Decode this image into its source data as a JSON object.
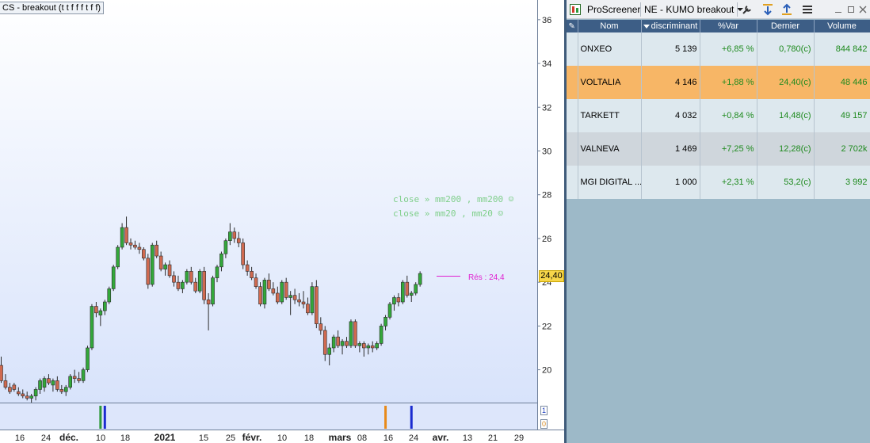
{
  "chart": {
    "title": "CS - breakout (t t f f f t f f)",
    "last_price_tag": "24,40",
    "resistance_label": "Rés : 24,4",
    "screener_notes": [
      "close » mm200 , mm200 ☺",
      "close » mm20 , mm20 ☺"
    ],
    "indicator_scale": [
      "1",
      "0"
    ]
  },
  "chart_data": {
    "type": "candlestick",
    "title": "CS - breakout (t t f f f t f f)",
    "y_ticks": [
      20,
      22,
      24,
      26,
      28,
      30,
      32,
      34,
      36
    ],
    "ylim": [
      18.5,
      36.9
    ],
    "x_ticks": [
      "16",
      "24",
      "déc.",
      "10",
      "18",
      "2021",
      "15",
      "25",
      "févr.",
      "10",
      "18",
      "mars",
      "08",
      "16",
      "24",
      "avr.",
      "13",
      "21",
      "29"
    ],
    "last_price": 24.4,
    "resistance": 24.4,
    "candles": [
      {
        "o": 20.2,
        "h": 20.6,
        "l": 19.4,
        "c": 19.5
      },
      {
        "o": 19.5,
        "h": 19.8,
        "l": 19.1,
        "c": 19.2
      },
      {
        "o": 19.2,
        "h": 19.4,
        "l": 18.9,
        "c": 19.0
      },
      {
        "o": 19.3,
        "h": 19.4,
        "l": 19.0,
        "c": 19.1
      },
      {
        "o": 19.0,
        "h": 19.2,
        "l": 18.8,
        "c": 18.9
      },
      {
        "o": 18.9,
        "h": 19.1,
        "l": 18.7,
        "c": 18.8
      },
      {
        "o": 18.8,
        "h": 19.0,
        "l": 18.6,
        "c": 18.7
      },
      {
        "o": 18.7,
        "h": 18.9,
        "l": 18.5,
        "c": 18.8
      },
      {
        "o": 18.8,
        "h": 19.2,
        "l": 18.6,
        "c": 19.1
      },
      {
        "o": 19.1,
        "h": 19.6,
        "l": 18.9,
        "c": 19.5
      },
      {
        "o": 19.2,
        "h": 19.7,
        "l": 19.0,
        "c": 19.6
      },
      {
        "o": 19.6,
        "h": 19.8,
        "l": 19.3,
        "c": 19.4
      },
      {
        "o": 19.3,
        "h": 19.6,
        "l": 19.0,
        "c": 19.5
      },
      {
        "o": 19.5,
        "h": 19.7,
        "l": 19.0,
        "c": 19.1
      },
      {
        "o": 19.1,
        "h": 19.3,
        "l": 18.9,
        "c": 19.0
      },
      {
        "o": 19.0,
        "h": 19.3,
        "l": 18.8,
        "c": 19.2
      },
      {
        "o": 19.2,
        "h": 19.8,
        "l": 19.1,
        "c": 19.7
      },
      {
        "o": 19.7,
        "h": 20.0,
        "l": 19.4,
        "c": 19.6
      },
      {
        "o": 19.6,
        "h": 19.9,
        "l": 19.4,
        "c": 19.5
      },
      {
        "o": 19.5,
        "h": 20.1,
        "l": 19.4,
        "c": 20.0
      },
      {
        "o": 20.0,
        "h": 21.1,
        "l": 19.9,
        "c": 21.0
      },
      {
        "o": 21.0,
        "h": 23.0,
        "l": 20.9,
        "c": 22.9
      },
      {
        "o": 22.9,
        "h": 23.1,
        "l": 22.4,
        "c": 22.6
      },
      {
        "o": 22.5,
        "h": 22.8,
        "l": 22.0,
        "c": 22.7
      },
      {
        "o": 22.7,
        "h": 23.2,
        "l": 22.5,
        "c": 23.1
      },
      {
        "o": 23.1,
        "h": 23.8,
        "l": 23.0,
        "c": 23.7
      },
      {
        "o": 23.7,
        "h": 24.8,
        "l": 23.6,
        "c": 24.7
      },
      {
        "o": 24.7,
        "h": 25.7,
        "l": 24.6,
        "c": 25.6
      },
      {
        "o": 25.6,
        "h": 26.7,
        "l": 25.5,
        "c": 26.5
      },
      {
        "o": 26.5,
        "h": 27.0,
        "l": 25.7,
        "c": 25.8
      },
      {
        "o": 25.8,
        "h": 26.0,
        "l": 25.5,
        "c": 25.7
      },
      {
        "o": 25.7,
        "h": 25.9,
        "l": 25.5,
        "c": 25.6
      },
      {
        "o": 25.6,
        "h": 25.8,
        "l": 25.3,
        "c": 25.5
      },
      {
        "o": 25.5,
        "h": 25.6,
        "l": 25.0,
        "c": 25.1
      },
      {
        "o": 25.1,
        "h": 25.3,
        "l": 23.7,
        "c": 23.9
      },
      {
        "o": 23.9,
        "h": 25.8,
        "l": 23.8,
        "c": 25.7
      },
      {
        "o": 25.7,
        "h": 25.9,
        "l": 25.1,
        "c": 25.2
      },
      {
        "o": 25.2,
        "h": 25.4,
        "l": 24.5,
        "c": 24.6
      },
      {
        "o": 24.6,
        "h": 24.9,
        "l": 24.3,
        "c": 24.8
      },
      {
        "o": 24.8,
        "h": 25.0,
        "l": 24.2,
        "c": 24.3
      },
      {
        "o": 24.3,
        "h": 24.5,
        "l": 23.8,
        "c": 24.0
      },
      {
        "o": 24.0,
        "h": 24.3,
        "l": 23.6,
        "c": 23.7
      },
      {
        "o": 23.7,
        "h": 24.1,
        "l": 23.5,
        "c": 24.0
      },
      {
        "o": 24.0,
        "h": 24.6,
        "l": 23.9,
        "c": 24.5
      },
      {
        "o": 24.5,
        "h": 24.7,
        "l": 23.9,
        "c": 24.0
      },
      {
        "o": 24.0,
        "h": 24.2,
        "l": 23.5,
        "c": 23.6
      },
      {
        "o": 23.6,
        "h": 24.6,
        "l": 23.5,
        "c": 24.5
      },
      {
        "o": 24.5,
        "h": 24.7,
        "l": 23.0,
        "c": 23.2
      },
      {
        "o": 23.2,
        "h": 23.5,
        "l": 21.8,
        "c": 23.0
      },
      {
        "o": 23.0,
        "h": 24.3,
        "l": 22.9,
        "c": 24.2
      },
      {
        "o": 24.2,
        "h": 24.8,
        "l": 24.0,
        "c": 24.7
      },
      {
        "o": 24.7,
        "h": 25.4,
        "l": 24.5,
        "c": 25.3
      },
      {
        "o": 25.3,
        "h": 26.0,
        "l": 25.1,
        "c": 25.9
      },
      {
        "o": 25.9,
        "h": 26.7,
        "l": 25.7,
        "c": 26.3
      },
      {
        "o": 26.3,
        "h": 26.5,
        "l": 25.8,
        "c": 26.0
      },
      {
        "o": 26.0,
        "h": 26.3,
        "l": 25.6,
        "c": 25.8
      },
      {
        "o": 25.8,
        "h": 26.0,
        "l": 24.6,
        "c": 24.8
      },
      {
        "o": 24.8,
        "h": 25.0,
        "l": 24.3,
        "c": 24.5
      },
      {
        "o": 24.5,
        "h": 24.7,
        "l": 24.1,
        "c": 24.2
      },
      {
        "o": 24.2,
        "h": 24.4,
        "l": 23.7,
        "c": 23.8
      },
      {
        "o": 23.8,
        "h": 24.0,
        "l": 22.9,
        "c": 23.0
      },
      {
        "o": 23.0,
        "h": 24.2,
        "l": 22.8,
        "c": 24.1
      },
      {
        "o": 24.1,
        "h": 24.4,
        "l": 23.6,
        "c": 23.7
      },
      {
        "o": 23.7,
        "h": 24.0,
        "l": 23.4,
        "c": 23.5
      },
      {
        "o": 23.5,
        "h": 23.8,
        "l": 23.0,
        "c": 23.1
      },
      {
        "o": 23.1,
        "h": 24.1,
        "l": 23.0,
        "c": 24.0
      },
      {
        "o": 24.0,
        "h": 24.2,
        "l": 23.2,
        "c": 23.3
      },
      {
        "o": 23.3,
        "h": 23.6,
        "l": 22.5,
        "c": 23.4
      },
      {
        "o": 23.4,
        "h": 23.7,
        "l": 23.0,
        "c": 23.2
      },
      {
        "o": 23.2,
        "h": 23.5,
        "l": 22.9,
        "c": 23.1
      },
      {
        "o": 23.1,
        "h": 23.6,
        "l": 22.8,
        "c": 23.0
      },
      {
        "o": 23.0,
        "h": 23.3,
        "l": 22.5,
        "c": 22.6
      },
      {
        "o": 22.6,
        "h": 24.0,
        "l": 22.5,
        "c": 23.8
      },
      {
        "o": 23.8,
        "h": 24.1,
        "l": 21.9,
        "c": 22.1
      },
      {
        "o": 22.1,
        "h": 22.4,
        "l": 21.6,
        "c": 21.8
      },
      {
        "o": 21.8,
        "h": 22.0,
        "l": 20.4,
        "c": 20.7
      },
      {
        "o": 20.7,
        "h": 21.2,
        "l": 20.2,
        "c": 21.0
      },
      {
        "o": 21.0,
        "h": 21.6,
        "l": 20.8,
        "c": 21.5
      },
      {
        "o": 21.5,
        "h": 21.8,
        "l": 21.0,
        "c": 21.1
      },
      {
        "o": 21.1,
        "h": 21.4,
        "l": 20.7,
        "c": 21.3
      },
      {
        "o": 21.3,
        "h": 21.5,
        "l": 21.0,
        "c": 21.1
      },
      {
        "o": 21.1,
        "h": 22.3,
        "l": 21.0,
        "c": 22.2
      },
      {
        "o": 22.2,
        "h": 22.3,
        "l": 21.0,
        "c": 21.1
      },
      {
        "o": 21.1,
        "h": 21.3,
        "l": 20.8,
        "c": 21.2
      },
      {
        "o": 21.2,
        "h": 21.3,
        "l": 20.6,
        "c": 21.0
      },
      {
        "o": 21.0,
        "h": 21.2,
        "l": 20.7,
        "c": 21.1
      },
      {
        "o": 21.1,
        "h": 21.3,
        "l": 20.8,
        "c": 21.0
      },
      {
        "o": 21.0,
        "h": 21.3,
        "l": 20.9,
        "c": 21.2
      },
      {
        "o": 21.2,
        "h": 22.1,
        "l": 21.1,
        "c": 22.0
      },
      {
        "o": 22.0,
        "h": 22.5,
        "l": 21.8,
        "c": 22.4
      },
      {
        "o": 22.4,
        "h": 23.1,
        "l": 22.3,
        "c": 23.0
      },
      {
        "o": 23.0,
        "h": 23.4,
        "l": 22.7,
        "c": 23.3
      },
      {
        "o": 23.3,
        "h": 23.5,
        "l": 22.9,
        "c": 23.1
      },
      {
        "o": 23.1,
        "h": 24.1,
        "l": 23.0,
        "c": 24.0
      },
      {
        "o": 24.0,
        "h": 24.3,
        "l": 23.3,
        "c": 23.4
      },
      {
        "o": 23.4,
        "h": 23.6,
        "l": 23.1,
        "c": 23.5
      },
      {
        "o": 23.5,
        "h": 24.0,
        "l": 23.4,
        "c": 23.9
      },
      {
        "o": 23.9,
        "h": 24.5,
        "l": 23.8,
        "c": 24.4
      }
    ],
    "signals": [
      {
        "index": 23,
        "color": "#2e9a3a"
      },
      {
        "index": 24,
        "color": "#1a2bd0"
      },
      {
        "index": 89,
        "color": "#e88a1a"
      },
      {
        "index": 95,
        "color": "#1a2bd0"
      }
    ]
  },
  "screener": {
    "title": "ProScreener",
    "selected_screen": "NE - KUMO breakout",
    "icons": [
      "app-icon",
      "wrench-icon",
      "sort-down-icon",
      "sort-up-icon",
      "menu-icon",
      "minimize-icon",
      "maximize-icon",
      "close-icon"
    ],
    "columns": [
      "Nom",
      "discriminant",
      "%Var",
      "Dernier",
      "Volume"
    ],
    "rows": [
      {
        "name": "ONXEO",
        "discriminant": "5 139",
        "var": "+6,85 %",
        "last": "0,780(c)",
        "volume": "844 842"
      },
      {
        "name": "VOLTALIA",
        "discriminant": "4 146",
        "var": "+1,88 %",
        "last": "24,40(c)",
        "volume": "48 446"
      },
      {
        "name": "TARKETT",
        "discriminant": "4 032",
        "var": "+0,84 %",
        "last": "14,48(c)",
        "volume": "49 157"
      },
      {
        "name": "VALNEVA",
        "discriminant": "1 469",
        "var": "+7,25 %",
        "last": "12,28(c)",
        "volume": "2 702k"
      },
      {
        "name": "MGI DIGITAL ...",
        "discriminant": "1 000",
        "var": "+2,31 %",
        "last": "53,2(c)",
        "volume": "3 992"
      }
    ],
    "highlighted_row": 1,
    "colors": {
      "header": "#3d5e86",
      "highlight": "#f7b666",
      "positive": "#1e8a1e",
      "background": "#9db9c8"
    }
  }
}
